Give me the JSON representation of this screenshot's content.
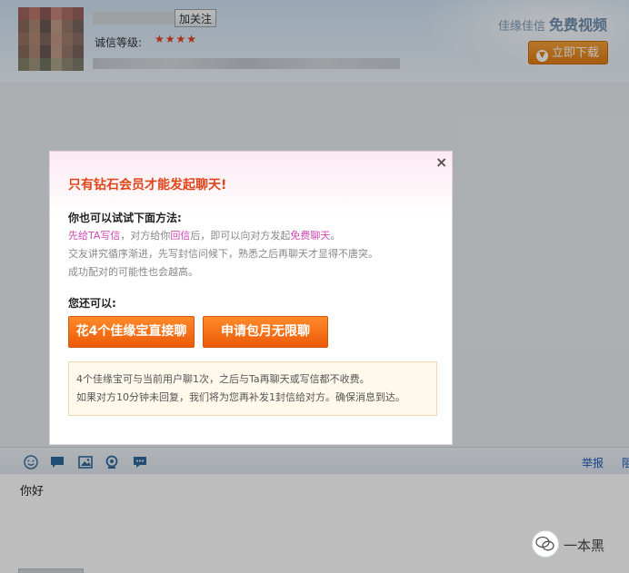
{
  "header": {
    "follow_label": "加关注",
    "level_label": "诚信等级:",
    "stars": "★★★★",
    "promo_text": "佳缘佳信",
    "promo_strong": "免费视频",
    "download_label": "立即下载"
  },
  "modal": {
    "close": "×",
    "title": "只有钻石会员才能发起聊天!",
    "try_heading": "你也可以试试下面方法:",
    "tip1": {
      "a": "先给TA写信",
      "b": "，对方给你",
      "c": "回信",
      "d": "后，即可以向对方发起",
      "e": "免费聊天",
      "f": "。"
    },
    "tip2": "交友讲究循序渐进，先写封信问候下，熟悉之后再聊天才显得不唐突。",
    "tip3": "成功配对的可能性也会越高。",
    "also_heading": "您还可以:",
    "button_spend": "花4个佳缘宝直接聊",
    "button_monthly": "申请包月无限聊",
    "notice_line1": "4个佳缘宝可与当前用户聊1次，之后与Ta再聊天或写信都不收费。",
    "notice_line2": "如果对方10分钟未回复，我们将为您再补发1封信给对方。确保消息到达。"
  },
  "toolbar": {
    "icons": [
      "smiley-icon",
      "chat-bubble-icon",
      "image-icon",
      "webcam-icon",
      "speech-icon"
    ],
    "report_label": "举报",
    "extra_label": "阻"
  },
  "input": {
    "text": "你好"
  },
  "watermark": {
    "text": "一本黑"
  },
  "colors": {
    "title_red": "#e0451a",
    "button_orange": "#ec5a08",
    "highlight_pink": "#d047b2",
    "link_blue": "#1f58b6"
  }
}
